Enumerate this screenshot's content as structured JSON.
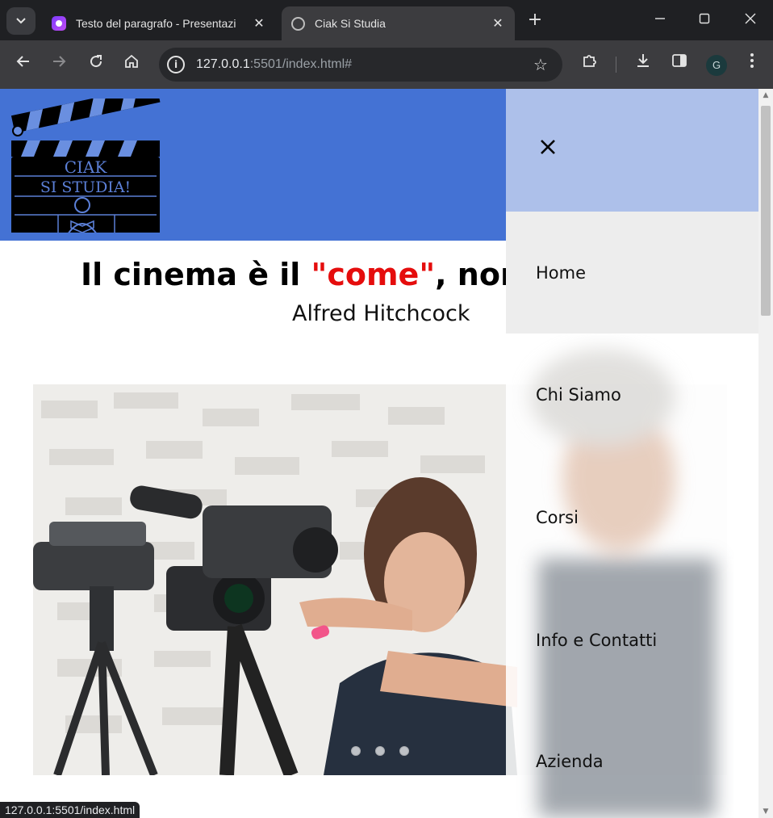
{
  "browser": {
    "tabs": [
      {
        "title": "Testo del paragrafo - Presentazi",
        "favicon": "canva-icon",
        "active": false
      },
      {
        "title": "Ciak Si Studia",
        "favicon": "globe-icon",
        "active": true
      }
    ],
    "address": {
      "host": "127.0.0.1",
      "rest": ":5501/index.html#"
    },
    "profile_initial": "G",
    "status_url": "127.0.0.1:5501/index.html"
  },
  "site": {
    "logo": {
      "line1": "CIAK",
      "line2": "SI STUDIA!"
    },
    "quote": {
      "before": "Il cinema è il ",
      "accent": "\"come\"",
      "after": ", non il \"cosa\"",
      "author": "Alfred Hitchcock"
    },
    "carousel": {
      "slides": 3,
      "active": 0
    }
  },
  "drawer": {
    "items": [
      {
        "label": "Home",
        "current": true
      },
      {
        "label": "Chi Siamo",
        "current": false
      },
      {
        "label": "Corsi",
        "current": false
      },
      {
        "label": "Info e Contatti",
        "current": false
      },
      {
        "label": "Azienda",
        "current": false
      }
    ]
  },
  "colors": {
    "header": "#4472d4",
    "drawer_top": "#adc0ea",
    "accent": "#e50d0d"
  }
}
